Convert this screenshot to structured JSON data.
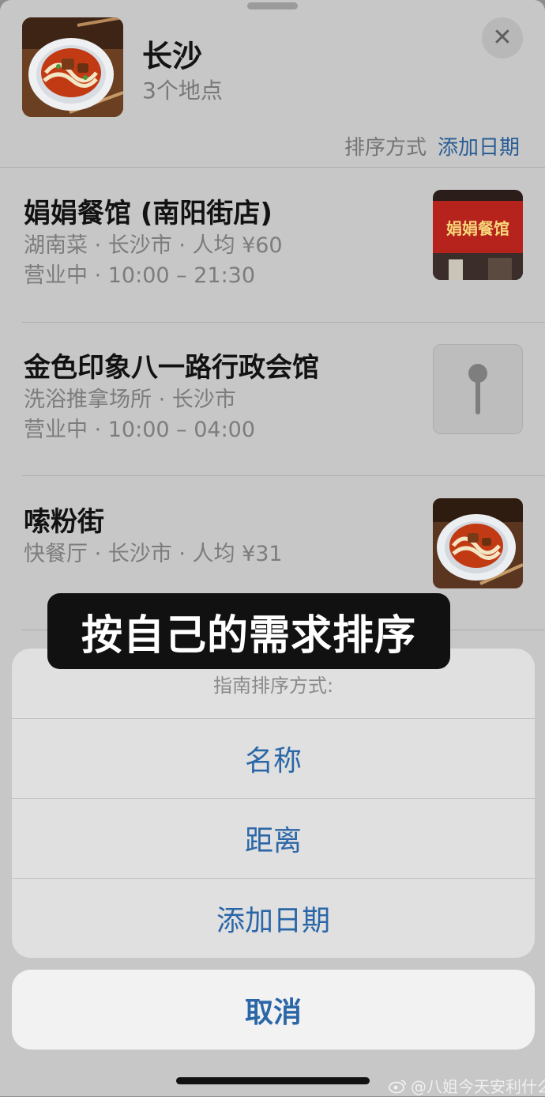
{
  "guide": {
    "title": "长沙",
    "count": "3个地点",
    "sort_label": "排序方式",
    "add_date_label": "添加日期",
    "close_icon": "close-icon"
  },
  "places": [
    {
      "name": "娟娟餐馆 (南阳街店)",
      "meta1": "湖南菜 · 长沙市 · 人均 ¥60",
      "meta2": "营业中 · 10:00 – 21:30",
      "thumb": "restaurant-photo",
      "sign_text": "娟娟餐馆"
    },
    {
      "name": "金色印象八一路行政会馆",
      "meta1": "洗浴推拿场所 · 长沙市",
      "meta2": "营业中 · 10:00 – 04:00",
      "thumb": "pin-icon"
    },
    {
      "name": "嗦粉街",
      "meta1": "快餐厅 · 长沙市 · 人均 ¥31",
      "thumb": "noodle-photo"
    }
  ],
  "caption": "按自己的需求排序",
  "action_sheet": {
    "header": "指南排序方式:",
    "options": [
      "名称",
      "距离",
      "添加日期"
    ],
    "cancel": "取消"
  },
  "watermark": "@八姐今天安利什么",
  "colors": {
    "accent": "#2b67a8",
    "sheet_bg": "#c7c7c7"
  }
}
